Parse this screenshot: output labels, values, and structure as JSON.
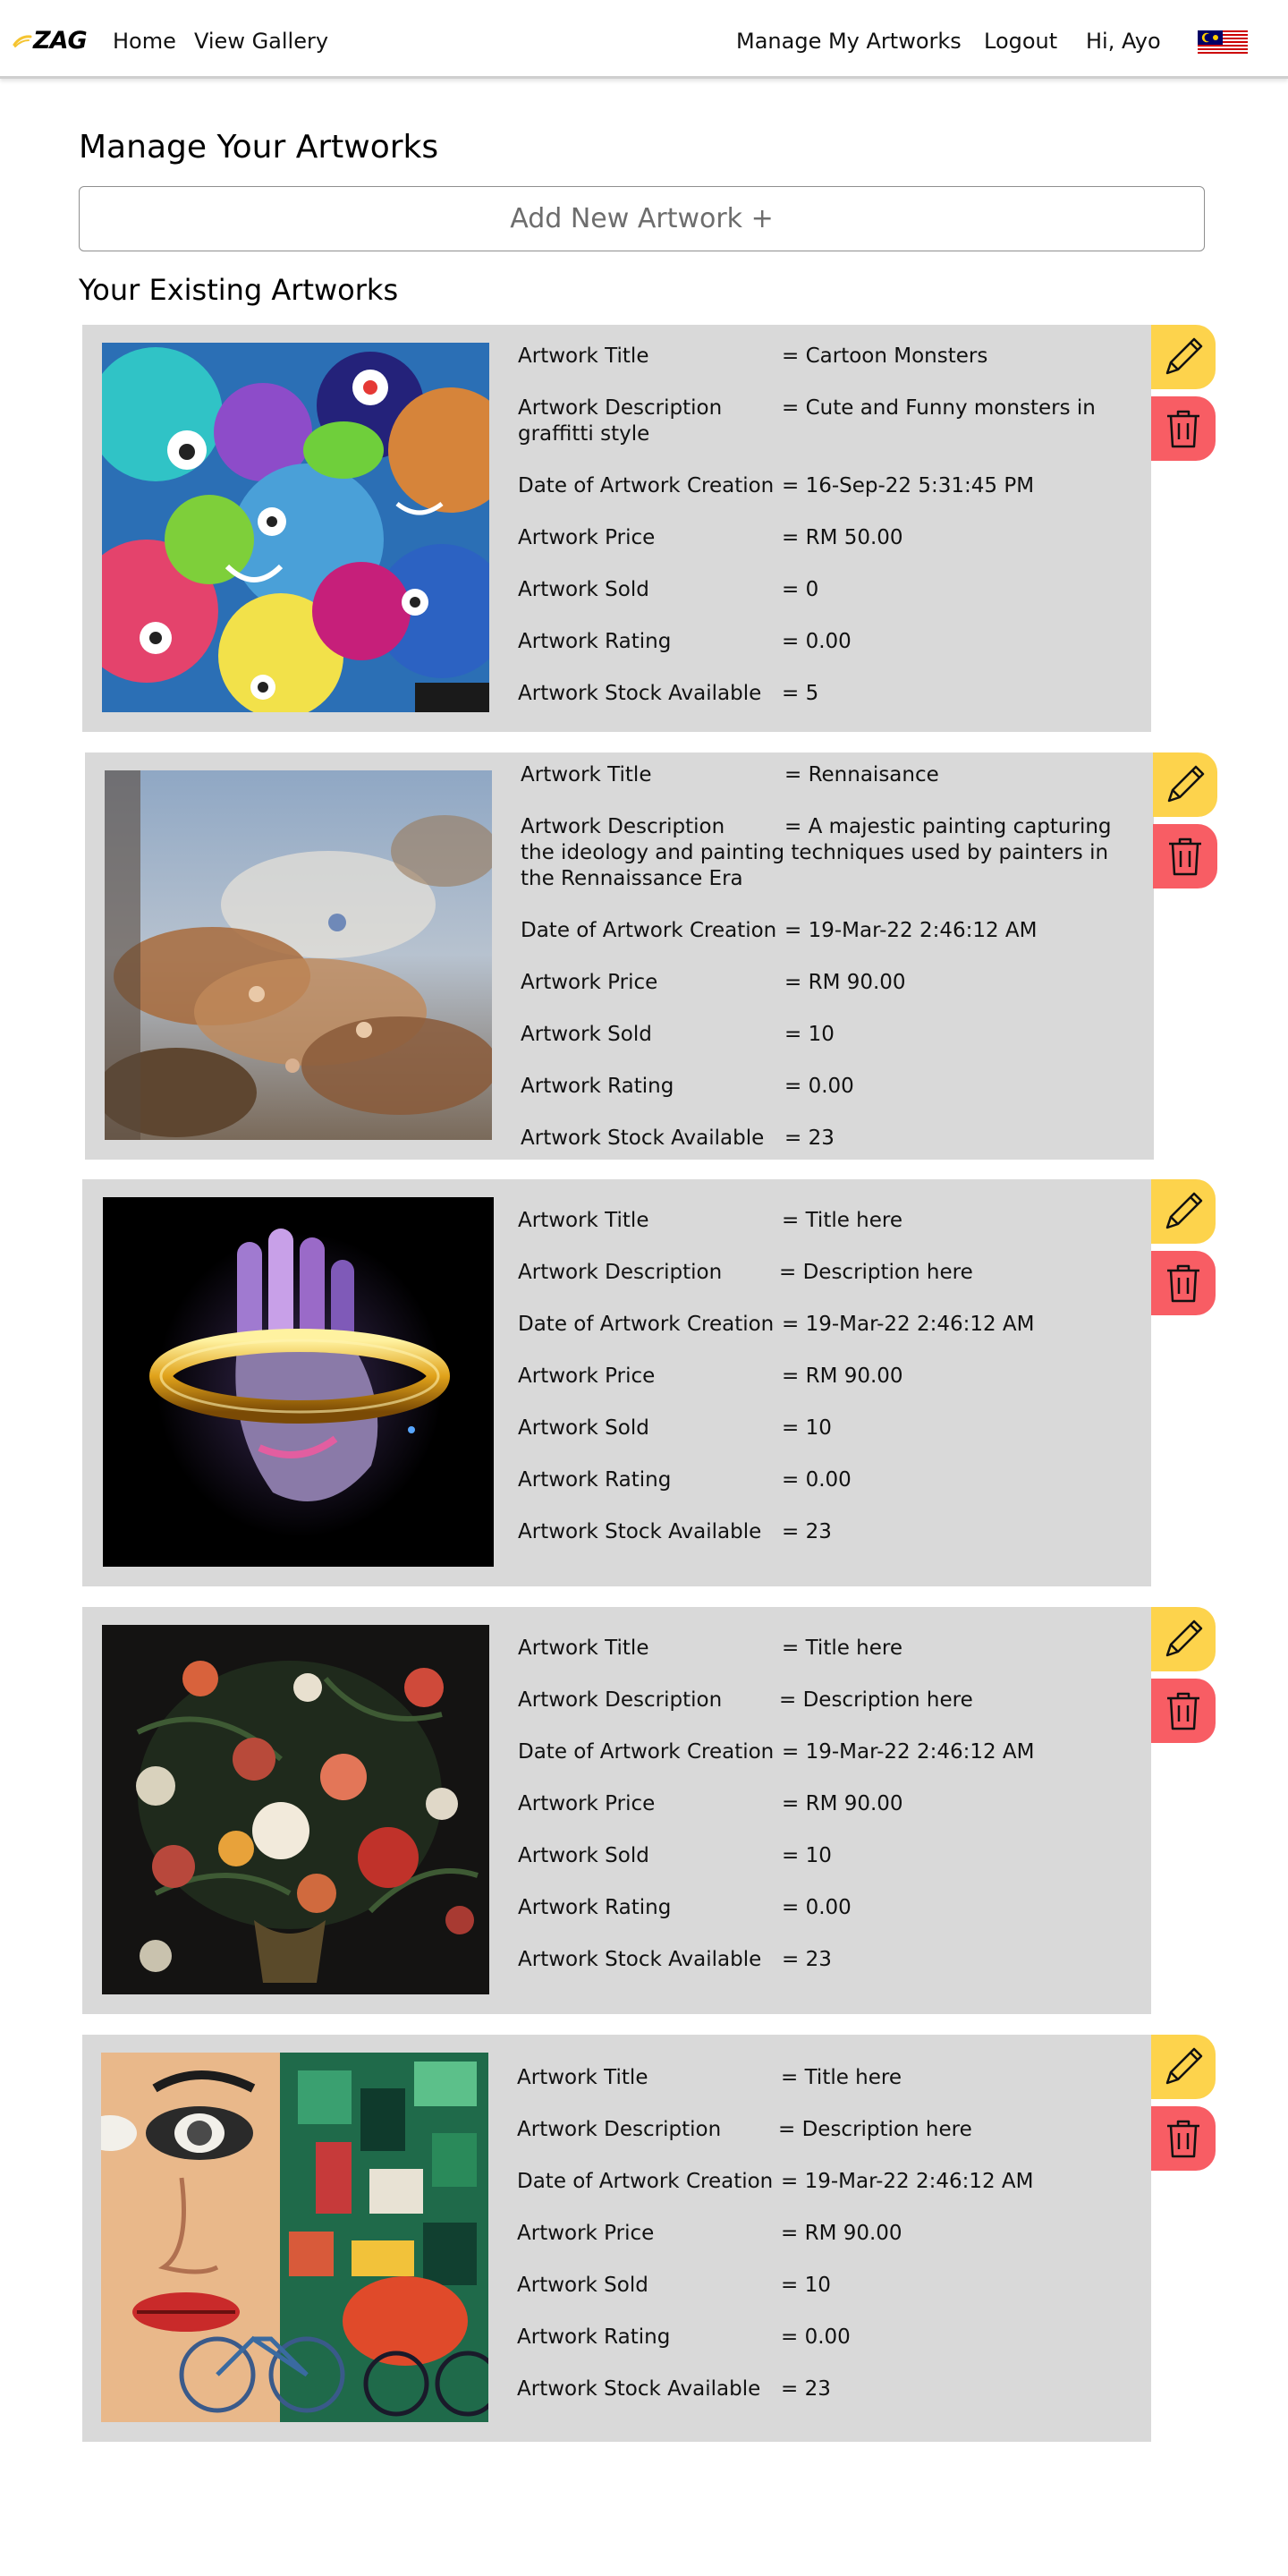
{
  "nav": {
    "brand": "ZAG",
    "home": "Home",
    "gallery": "View Gallery",
    "manage": "Manage My Artworks",
    "logout": "Logout",
    "greeting": "Hi, Ayo",
    "flag_icon": "malaysia-flag-icon"
  },
  "page": {
    "title": "Manage Your Artworks",
    "add_button": "Add New Artwork +",
    "section_title": "Your Existing Artworks"
  },
  "labels": {
    "title": "Artwork Title",
    "description": "Artwork Description",
    "date": "Date of Artwork Creation",
    "price": "Artwork Price",
    "sold": "Artwork Sold",
    "rating": "Artwork Rating",
    "stock": "Artwork Stock Available"
  },
  "colors": {
    "edit": "#fdd34c",
    "delete": "#f85d64",
    "card": "#d9d9d9"
  },
  "artworks": [
    {
      "image": "cartoon-monsters-graffiti",
      "title": "= Cartoon Monsters",
      "description": "= Cute and Funny monsters in graffitti style",
      "description_lead": "= Cute and Funny monsters in",
      "description_rest": "graffitti style",
      "date": "= 16-Sep-22 5:31:45 PM",
      "price": "= RM 50.00",
      "sold": "= 0",
      "rating": "= 0.00",
      "stock": "= 5"
    },
    {
      "image": "renaissance-ceiling-painting",
      "title": "= Rennaisance",
      "description_lead": "= A majestic painting capturing",
      "description_rest": "the ideology and painting techniques used by painters in the Rennaissance Era",
      "date": "= 19-Mar-22 2:46:12 AM",
      "price": "= RM 90.00",
      "sold": "= 10",
      "rating": "= 0.00",
      "stock": "= 23"
    },
    {
      "image": "chrome-hand-with-gold-ring",
      "title": "= Title here",
      "description": "= Description here",
      "date": "= 19-Mar-22 2:46:12 AM",
      "price": "= RM 90.00",
      "sold": "= 10",
      "rating": "= 0.00",
      "stock": "= 23"
    },
    {
      "image": "dark-floral-still-life",
      "title": "= Title here",
      "description": "= Description here",
      "date": "= 19-Mar-22 2:46:12 AM",
      "price": "= RM 90.00",
      "sold": "= 10",
      "rating": "= 0.00",
      "stock": "= 23"
    },
    {
      "image": "cubist-face-mural-with-bicycles",
      "title": "= Title here",
      "description": "= Description here",
      "date": "= 19-Mar-22 2:46:12 AM",
      "price": "= RM 90.00",
      "sold": "= 10",
      "rating": "= 0.00",
      "stock": "= 23"
    }
  ]
}
